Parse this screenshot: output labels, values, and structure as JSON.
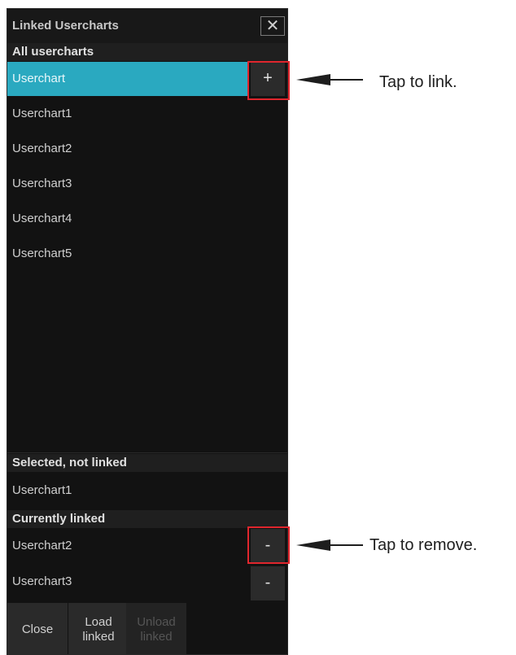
{
  "window": {
    "title": "Linked Usercharts",
    "close_icon": "close-icon"
  },
  "all_section": {
    "header": "All usercharts",
    "items": [
      {
        "label": "Userchart",
        "selected": true,
        "button": "+"
      },
      {
        "label": "Userchart1"
      },
      {
        "label": "Userchart2"
      },
      {
        "label": "Userchart3"
      },
      {
        "label": "Userchart4"
      },
      {
        "label": "Userchart5"
      }
    ]
  },
  "selected_section": {
    "header": "Selected, not linked",
    "items": [
      {
        "label": "Userchart1"
      }
    ]
  },
  "linked_section": {
    "header": "Currently linked",
    "items": [
      {
        "label": "Userchart2",
        "button": "-"
      },
      {
        "label": "Userchart3",
        "button": "-"
      }
    ]
  },
  "footer": {
    "close_label": "Close",
    "load_label_1": "Load",
    "load_label_2": "linked",
    "unload_label_1": "Unload",
    "unload_label_2": "linked"
  },
  "annotations": {
    "link_text": "Tap to link.",
    "remove_text": "Tap to remove."
  },
  "colors": {
    "selected_row": "#2aa9c0",
    "highlight_box": "#e0262d",
    "panel_bg": "#121212"
  }
}
